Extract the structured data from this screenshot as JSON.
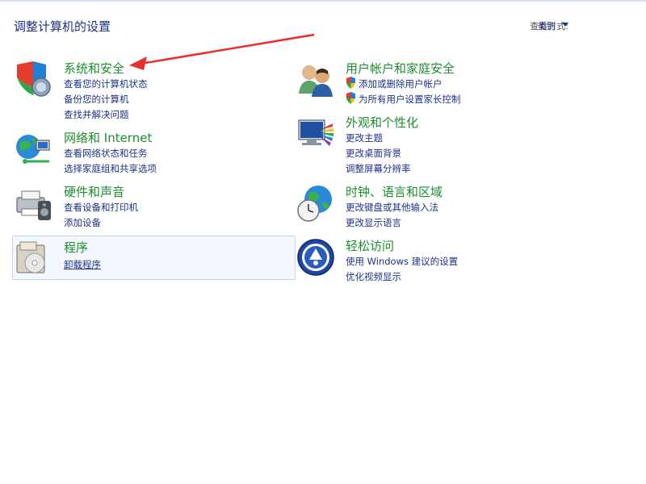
{
  "page_title": "调整计算机的设置",
  "view_by": {
    "label": "查看方式:",
    "value": "类别"
  },
  "categories": [
    {
      "title": "系统和安全",
      "links": [
        "查看您的计算机状态",
        "备份您的计算机",
        "查找并解决问题"
      ],
      "icon": "system-security-icon"
    },
    {
      "title": "网络和 Internet",
      "links": [
        "查看网络状态和任务",
        "选择家庭组和共享选项"
      ],
      "icon": "network-internet-icon"
    },
    {
      "title": "硬件和声音",
      "links": [
        "查看设备和打印机",
        "添加设备"
      ],
      "icon": "hardware-sound-icon"
    },
    {
      "title": "程序",
      "links": [
        "卸载程序"
      ],
      "icon": "programs-icon"
    },
    {
      "title": "用户帐户和家庭安全",
      "links": [
        "添加或删除用户帐户",
        "为所有用户设置家长控制"
      ],
      "icon": "user-accounts-icon"
    },
    {
      "title": "外观和个性化",
      "links": [
        "更改主题",
        "更改桌面背景",
        "调整屏幕分辨率"
      ],
      "icon": "appearance-icon"
    },
    {
      "title": "时钟、语言和区域",
      "links": [
        "更改键盘或其他输入法",
        "更改显示语言"
      ],
      "icon": "clock-language-icon"
    },
    {
      "title": "轻松访问",
      "links": [
        "使用 Windows 建议的设置",
        "优化视频显示"
      ],
      "icon": "ease-of-access-icon"
    }
  ],
  "colors": {
    "title_green": "#1b8e2d",
    "link_blue": "#1e3287",
    "arrow_red": "#e8302a"
  }
}
